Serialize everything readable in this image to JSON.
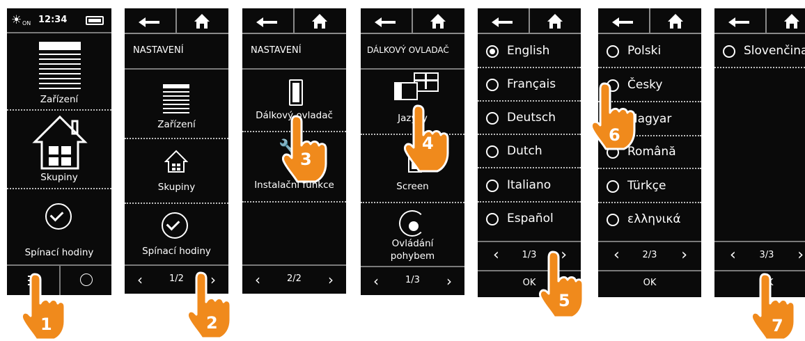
{
  "screen1": {
    "status_time": "12:34",
    "status_on": "ON",
    "items": [
      "Zařízení",
      "Skupiny",
      "Spínací hodiny"
    ]
  },
  "screen2": {
    "title": "NASTAVENÍ",
    "items": [
      "Zařízení",
      "Skupiny",
      "Spínací hodiny"
    ],
    "page": "1/2"
  },
  "screen3": {
    "title": "NASTAVENÍ",
    "items": [
      "Dálkový ovladač",
      "Instalační funkce"
    ],
    "page": "2/2"
  },
  "screen4": {
    "title": "DÁLKOVÝ OVLADAČ",
    "items": [
      "Jazyky",
      "Screen",
      "Ovládání",
      "pohybem"
    ],
    "page": "1/3"
  },
  "screen5": {
    "languages": [
      "English",
      "Français",
      "Deutsch",
      "Dutch",
      "Italiano",
      "Español"
    ],
    "selected": "English",
    "page": "1/3",
    "ok": "OK"
  },
  "screen6": {
    "languages": [
      "Polski",
      "Česky",
      "Magyar",
      "Română",
      "Türkçe",
      "ελληνικά"
    ],
    "page": "2/3",
    "ok": "OK"
  },
  "screen7": {
    "languages": [
      "Slovenčina"
    ],
    "page": "3/3",
    "ok": "OK"
  },
  "steps": [
    "1",
    "2",
    "3",
    "4",
    "5",
    "6",
    "7"
  ],
  "colors": {
    "screen_bg": "#0a0a0a",
    "hand": "#f08a1c",
    "hand_outline": "#ffffff"
  }
}
